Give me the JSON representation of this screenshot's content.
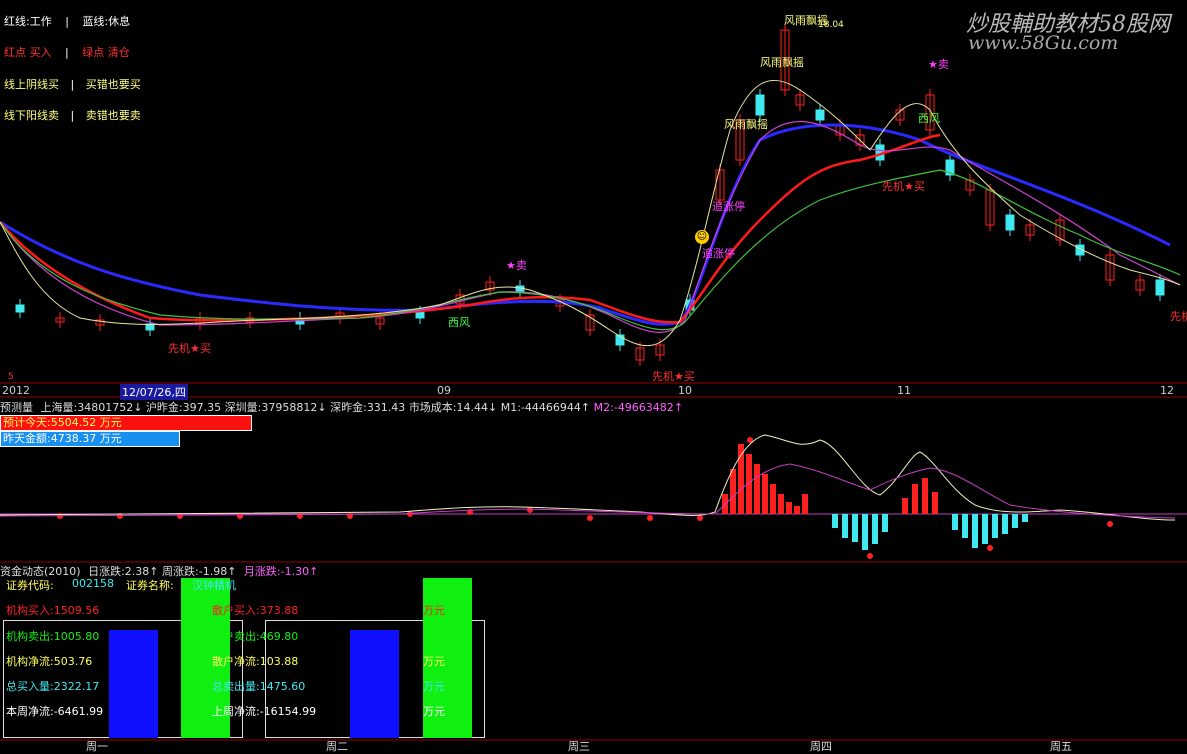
{
  "watermark": {
    "title": "炒股輔助教材58股网",
    "url": "www.58Gu.com"
  },
  "legend": [
    {
      "a": "红线:工作",
      "sep": "|",
      "b": "蓝线:休息",
      "a_color": "#ffffff",
      "b_color": "#ffffff"
    },
    {
      "a": "红点 买入",
      "sep": "|",
      "b": "绿点 清仓",
      "a_color": "#ff3030",
      "b_color": "#ff3030"
    },
    {
      "a": "线上阴线买",
      "sep": "|",
      "b": "买错也要买",
      "a_color": "#ffff80",
      "b_color": "#ffff80"
    },
    {
      "a": "线下阳线卖",
      "sep": "|",
      "b": "卖错也要卖",
      "a_color": "#ffff80",
      "b_color": "#ffff80"
    }
  ],
  "chart_annotations": {
    "fengyu1": "风雨飘摇",
    "fengyu2": "风雨飘摇",
    "fengyu3": "风雨飘摇",
    "top_value": "18.04",
    "sell1": "★卖",
    "sell2": "★卖",
    "buy1": "先机★买",
    "buy2": "先机★买",
    "buy3": "先机★买",
    "buy4": "先机",
    "xifeng1": "西风",
    "xifeng2": "西风",
    "zhuizhang1": "追涨停",
    "zhuizhang2": "追涨停",
    "left_mark": "5"
  },
  "date_axis": {
    "labels": [
      "2012",
      "09",
      "10",
      "11",
      "12"
    ],
    "highlight": "12/07/26,四"
  },
  "volume_line": {
    "prefix": "预测量",
    "sh_label": "上海量:",
    "sh_value": "34801752",
    "sh_prev_label": "沪昨金:",
    "sh_prev_value": "397.35",
    "sz_label": "深圳量:",
    "sz_value": "37958812",
    "sz_prev_label": "深昨金:",
    "sz_prev_value": "331.43",
    "cost_label": "市场成本:",
    "cost_value": "14.44",
    "m1_label": "M1:",
    "m1_value": "-44466944",
    "m2_label": "M2:",
    "m2_value": "-49663482"
  },
  "forecast_bar": {
    "label": "预计今天:",
    "value": "5504.52 万元"
  },
  "yesterday_bar": {
    "label": "昨天金额:",
    "value": "4738.37 万元"
  },
  "fund_header": {
    "title": "资金动态(2010)",
    "day_label": "日涨跌:",
    "day_value": "2.38↑",
    "week_label": "周涨跌:",
    "week_value": "-1.98↑",
    "month_label": "月涨跌:",
    "month_value": "-1.30↑"
  },
  "stock": {
    "code_label": "证券代码:",
    "code": "002158",
    "name_label": "证券名称:",
    "name": "汉钟精机"
  },
  "fund_rows": {
    "inst_buy": "机构买入:1509.56",
    "retail_buy": "散户买入:373.88",
    "unit1": "万元",
    "inst_sell": "机构卖出:1005.80",
    "retail_sell": "散户卖出:469.80",
    "inst_net": "机构净流:503.76",
    "retail_net": "散户净流:103.88",
    "unit2": "万元",
    "total_buy": "总买入量:2322.17",
    "total_sell": "总卖出量:1475.60",
    "unit3": "万元",
    "week_net": "本周净流:-6461.99",
    "last_week_net": "上周净流:-16154.99",
    "unit4": "万元"
  },
  "weekdays": [
    "周一",
    "周二",
    "周三",
    "周四",
    "周五"
  ],
  "colors": {
    "red": "#ff2020",
    "cyan": "#40e8f0",
    "blue": "#1010ff",
    "green": "#10f010",
    "magenta": "#ff40ff",
    "yellow": "#ffff60"
  }
}
